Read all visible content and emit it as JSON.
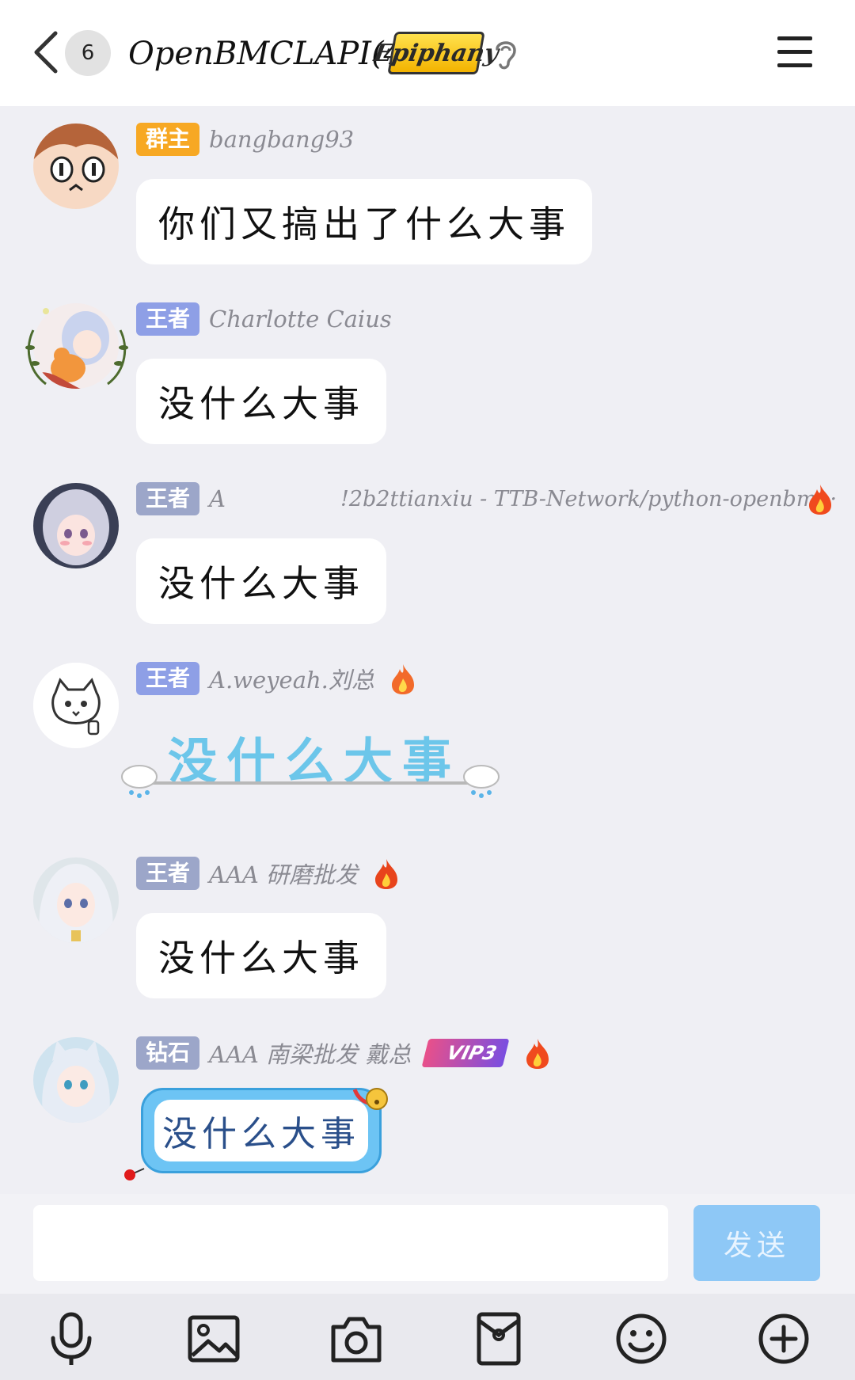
{
  "header": {
    "unread_count": "6",
    "group_title": "OpenBMCLAPI(411)",
    "title_badge": "Epiphany"
  },
  "messages": [
    {
      "role": "群主",
      "role_color": "#f7a823",
      "nick": "bangbang93",
      "text": "你们又搞出了什么大事",
      "flame": false
    },
    {
      "role": "王者",
      "role_color": "#8e9fe6",
      "nick": "Charlotte Caius",
      "text": "没什么大事",
      "flame": false
    },
    {
      "role": "王者",
      "role_color": "#9ca6c9",
      "nick": "A",
      "extra": "!2b2ttianxiu - TTB-Network/python-openbm ··",
      "text": "没什么大事",
      "flame": true
    },
    {
      "role": "王者",
      "role_color": "#8e9fe6",
      "nick": "A.weyeah.刘总",
      "text": "没什么大事",
      "flame": true
    },
    {
      "role": "王者",
      "role_color": "#9ca6c9",
      "nick": "AAA 研磨批发",
      "text": "没什么大事",
      "flame": true
    },
    {
      "role": "钻石",
      "role_color": "#9ca6c9",
      "nick": "AAA 南梁批发 戴总",
      "vip": "VIP3",
      "text": "没什么大事",
      "flame": true
    }
  ],
  "composer": {
    "input_value": "",
    "send_label": "发送"
  },
  "toolbar": [
    "microphone-icon",
    "image-icon",
    "camera-icon",
    "red-packet-icon",
    "emoji-icon",
    "plus-icon"
  ],
  "colors": {
    "background": "#efeff4",
    "bubble": "#ffffff",
    "send_button": "#8ec8f6",
    "accent_blue": "#5ab4e8"
  }
}
